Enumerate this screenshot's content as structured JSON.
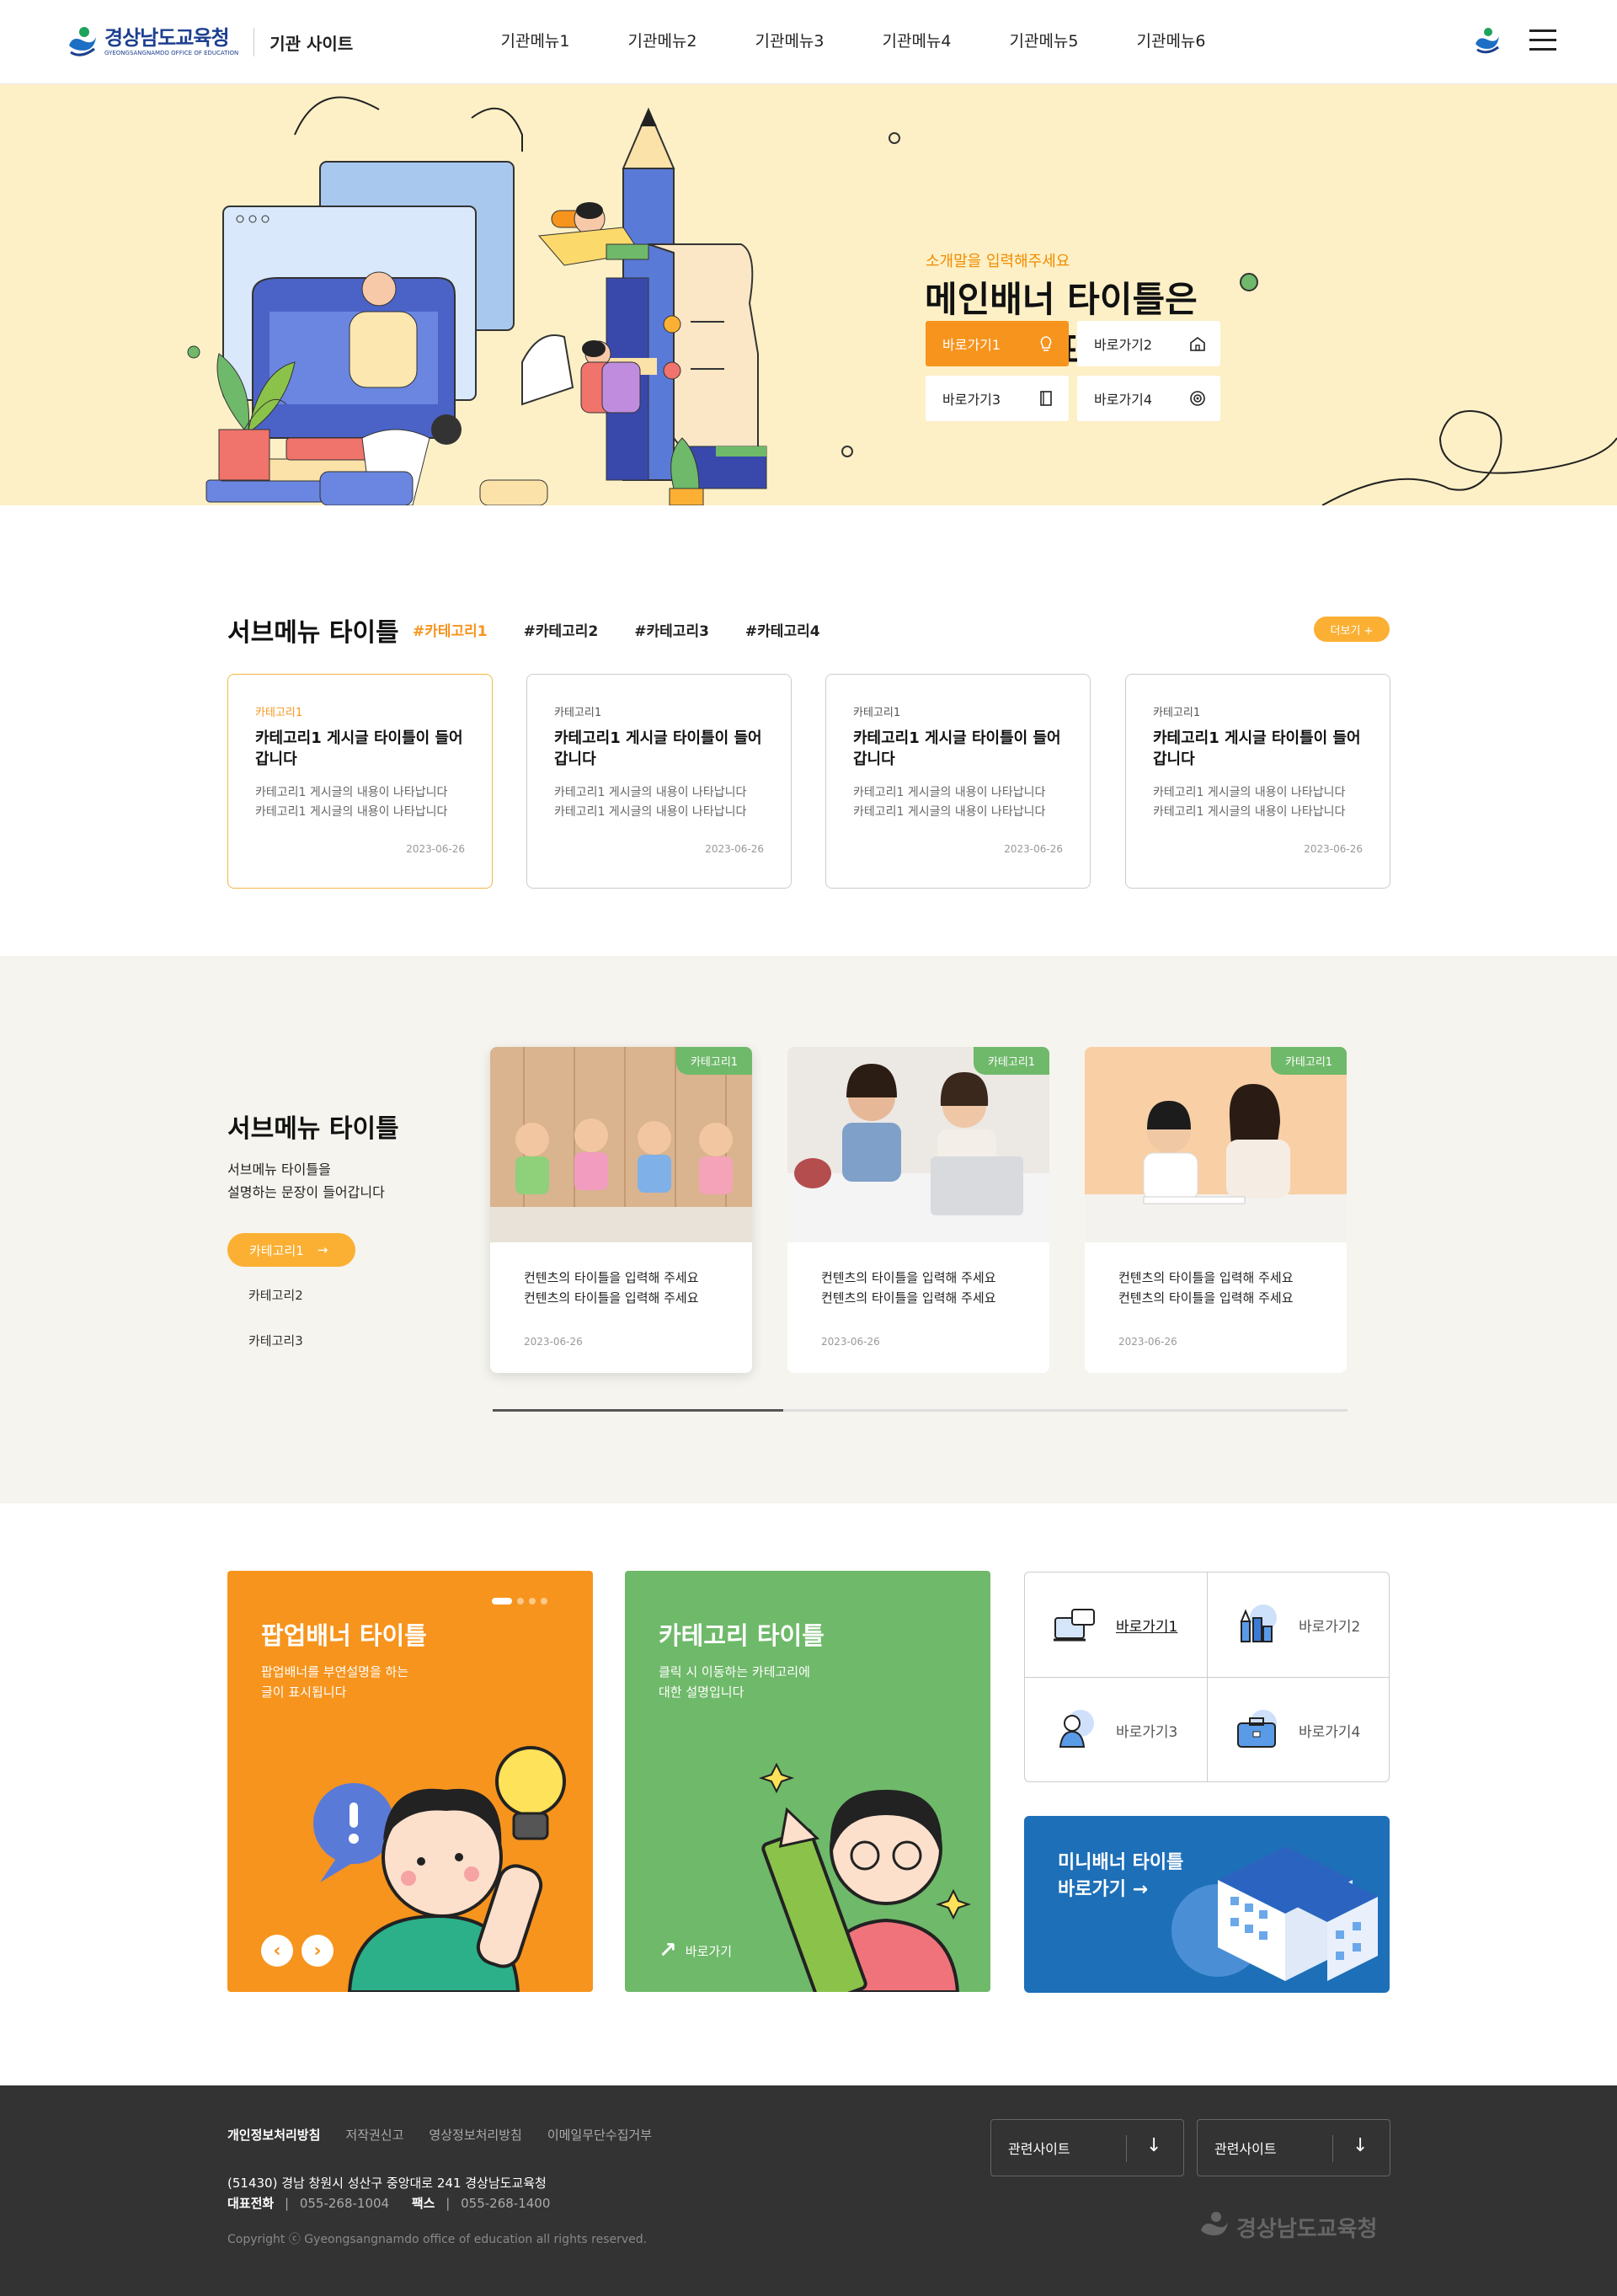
{
  "header": {
    "logo_ko": "경상남도교육청",
    "logo_en": "GYEONGSANGNAMDO OFFICE OF EDUCATION",
    "site_name": "기관 사이트",
    "menu": [
      "기관메뉴1",
      "기관메뉴2",
      "기관메뉴3",
      "기관메뉴4",
      "기관메뉴5",
      "기관메뉴6"
    ]
  },
  "hero": {
    "subtitle": "소개말을 입력해주세요",
    "title_line1": "메인배너 타이틀은",
    "title_line2": "두 줄로 표시됩니다",
    "buttons": [
      {
        "label": "바로가기1",
        "icon": "lightbulb-icon"
      },
      {
        "label": "바로가기2",
        "icon": "building-icon"
      },
      {
        "label": "바로가기3",
        "icon": "book-icon"
      },
      {
        "label": "바로가기4",
        "icon": "target-icon"
      }
    ]
  },
  "section1": {
    "title": "서브메뉴 타이틀",
    "tabs": [
      "#카테고리1",
      "#카테고리2",
      "#카테고리3",
      "#카테고리4"
    ],
    "more": "더보기 +",
    "cards": [
      {
        "cat": "카테고리1",
        "title": "카테고리1 게시글 타이틀이 들어 갑니다",
        "body1": "카테고리1 게시글의 내용이 나타납니다",
        "body2": "카테고리1 게시글의 내용이 나타납니다",
        "date": "2023-06-26"
      },
      {
        "cat": "카테고리1",
        "title": "카테고리1 게시글 타이틀이 들어 갑니다",
        "body1": "카테고리1 게시글의 내용이 나타납니다",
        "body2": "카테고리1 게시글의 내용이 나타납니다",
        "date": "2023-06-26"
      },
      {
        "cat": "카테고리1",
        "title": "카테고리1 게시글 타이틀이 들어 갑니다",
        "body1": "카테고리1 게시글의 내용이 나타납니다",
        "body2": "카테고리1 게시글의 내용이 나타납니다",
        "date": "2023-06-26"
      },
      {
        "cat": "카테고리1",
        "title": "카테고리1 게시글 타이틀이 들어 갑니다",
        "body1": "카테고리1 게시글의 내용이 나타납니다",
        "body2": "카테고리1 게시글의 내용이 나타납니다",
        "date": "2023-06-26"
      }
    ]
  },
  "section2": {
    "title": "서브메뉴 타이틀",
    "desc1": "서브메뉴 타이틀을",
    "desc2": "설명하는 문장이 들어갑니다",
    "pill": "카테고리1",
    "links": [
      "카테고리2",
      "카테고리3"
    ],
    "cards": [
      {
        "badge": "카테고리1",
        "line1": "컨텐츠의 타이틀을 입력해 주세요",
        "line2": "컨텐츠의 타이틀을 입력해 주세요",
        "date": "2023-06-26"
      },
      {
        "badge": "카테고리1",
        "line1": "컨텐츠의 타이틀을 입력해 주세요",
        "line2": "컨텐츠의 타이틀을 입력해 주세요",
        "date": "2023-06-26"
      },
      {
        "badge": "카테고리1",
        "line1": "컨텐츠의 타이틀을 입력해 주세요",
        "line2": "컨텐츠의 타이틀을 입력해 주세요",
        "date": "2023-06-26"
      }
    ],
    "slider_progress": 0.34
  },
  "section3": {
    "popup": {
      "title": "팝업배너 타이틀",
      "desc1": "팝업배너를 부연설명을 하는",
      "desc2": "글이 표시됩니다",
      "prev": "‹",
      "next": "›"
    },
    "category": {
      "title": "카테고리 타이틀",
      "desc1": "클릭 시 이동하는 카테고리에",
      "desc2": "대한 설명입니다",
      "link": "바로가기"
    },
    "quick": [
      {
        "label": "바로가기1",
        "icon": "monitor-chat-icon"
      },
      {
        "label": "바로가기2",
        "icon": "pencil-ruler-icon"
      },
      {
        "label": "바로가기3",
        "icon": "person-icon"
      },
      {
        "label": "바로가기4",
        "icon": "briefcase-icon"
      }
    ],
    "mini": {
      "line1": "미니배너 타이틀",
      "line2": "바로가기 →"
    }
  },
  "footer": {
    "links": [
      "개인정보처리방침",
      "저작권신고",
      "영상정보처리방침",
      "이메일무단수집거부"
    ],
    "address": "(51430) 경남 창원시 성산구 중앙대로 241 경상남도교육청",
    "tel_label": "대표전화",
    "tel": "055-268-1004",
    "fax_label": "팩스",
    "fax": "055-268-1400",
    "copyright": "Copyright ⓒ Gyeongsangnamdo office of education all rights reserved.",
    "select1": "관련사이트",
    "select2": "관련사이트",
    "logo": "경상남도교육청"
  },
  "colors": {
    "orange": "#f7941d",
    "green": "#6fb96a",
    "blue": "#1d6fb8",
    "hero_bg": "#fdf0c6",
    "footer_bg": "#333333"
  }
}
